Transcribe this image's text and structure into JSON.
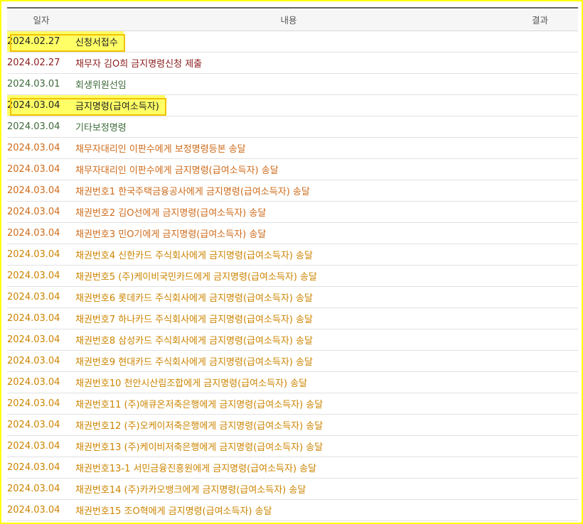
{
  "header": {
    "date_label": "일자",
    "content_label": "내용",
    "result_label": "결과"
  },
  "colors": {
    "frame_border": "#ffff00",
    "highlight": "#ffff66",
    "highlight_border": "#f2c200"
  },
  "rows": [
    {
      "date": "2024.02.27",
      "content": "신청서접수",
      "result": "",
      "tone": "black",
      "highlighted": true
    },
    {
      "date": "2024.02.27",
      "content": "채무자 김O희 금지명령신청 제출",
      "result": "",
      "tone": "maroon",
      "highlighted": false
    },
    {
      "date": "2024.03.01",
      "content": "회생위원선임",
      "result": "",
      "tone": "green",
      "highlighted": false
    },
    {
      "date": "2024.03.04",
      "content": "금지명령(급여소득자)",
      "result": "",
      "tone": "black",
      "highlighted": true
    },
    {
      "date": "2024.03.04",
      "content": "기타보정명령",
      "result": "",
      "tone": "green",
      "highlighted": false
    },
    {
      "date": "2024.03.04",
      "content": "채무자대리인 이판수에게 보정명령등본 송달",
      "result": "",
      "tone": "orange",
      "highlighted": false
    },
    {
      "date": "2024.03.04",
      "content": "채무자대리인 이판수에게 금지명령(급여소득자) 송달",
      "result": "",
      "tone": "orange",
      "highlighted": false
    },
    {
      "date": "2024.03.04",
      "content": "채권번호1 한국주택금융공사에게 금지명령(급여소득자) 송달",
      "result": "",
      "tone": "orange",
      "highlighted": false
    },
    {
      "date": "2024.03.04",
      "content": "채권번호2 김O선에게 금지명령(급여소득자) 송달",
      "result": "",
      "tone": "orange",
      "highlighted": false
    },
    {
      "date": "2024.03.04",
      "content": "채권번호3 민O기에게 금지명령(급여소득자) 송달",
      "result": "",
      "tone": "orange",
      "highlighted": false
    },
    {
      "date": "2024.03.04",
      "content": "채권번호4 신한카드 주식회사에게 금지명령(급여소득자) 송달",
      "result": "",
      "tone": "gold",
      "highlighted": false
    },
    {
      "date": "2024.03.04",
      "content": "채권번호5 (주)케이비국민카드에게 금지명령(급여소득자) 송달",
      "result": "",
      "tone": "gold",
      "highlighted": false
    },
    {
      "date": "2024.03.04",
      "content": "채권번호6 롯데카드 주식회사에게 금지명령(급여소득자) 송달",
      "result": "",
      "tone": "gold",
      "highlighted": false
    },
    {
      "date": "2024.03.04",
      "content": "채권번호7 하나카드 주식회사에게 금지명령(급여소득자) 송달",
      "result": "",
      "tone": "gold",
      "highlighted": false
    },
    {
      "date": "2024.03.04",
      "content": "채권번호8 삼성카드 주식회사에게 금지명령(급여소득자) 송달",
      "result": "",
      "tone": "gold",
      "highlighted": false
    },
    {
      "date": "2024.03.04",
      "content": "채권번호9 현대카드 주식회사에게 금지명령(급여소득자) 송달",
      "result": "",
      "tone": "gold",
      "highlighted": false
    },
    {
      "date": "2024.03.04",
      "content": "채권번호10 천안시산림조합에게 금지명령(급여소득자) 송달",
      "result": "",
      "tone": "gold",
      "highlighted": false
    },
    {
      "date": "2024.03.04",
      "content": "채권번호11 (주)애큐온저축은행에게 금지명령(급여소득자) 송달",
      "result": "",
      "tone": "gold",
      "highlighted": false
    },
    {
      "date": "2024.03.04",
      "content": "채권번호12 (주)오케이저축은행에게 금지명령(급여소득자) 송달",
      "result": "",
      "tone": "gold",
      "highlighted": false
    },
    {
      "date": "2024.03.04",
      "content": "채권번호13 (주)케이비저축은행에게 금지명령(급여소득자) 송달",
      "result": "",
      "tone": "gold",
      "highlighted": false
    },
    {
      "date": "2024.03.04",
      "content": "채권번호13-1 서민금융진흥원에게 금지명령(급여소득자) 송달",
      "result": "",
      "tone": "gold",
      "highlighted": false
    },
    {
      "date": "2024.03.04",
      "content": "채권번호14 (주)카카오뱅크에게 금지명령(급여소득자) 송달",
      "result": "",
      "tone": "gold",
      "highlighted": false
    },
    {
      "date": "2024.03.04",
      "content": "채권번호15 조O혁에게 금지명령(급여소득자) 송달",
      "result": "",
      "tone": "gold",
      "highlighted": false
    }
  ]
}
